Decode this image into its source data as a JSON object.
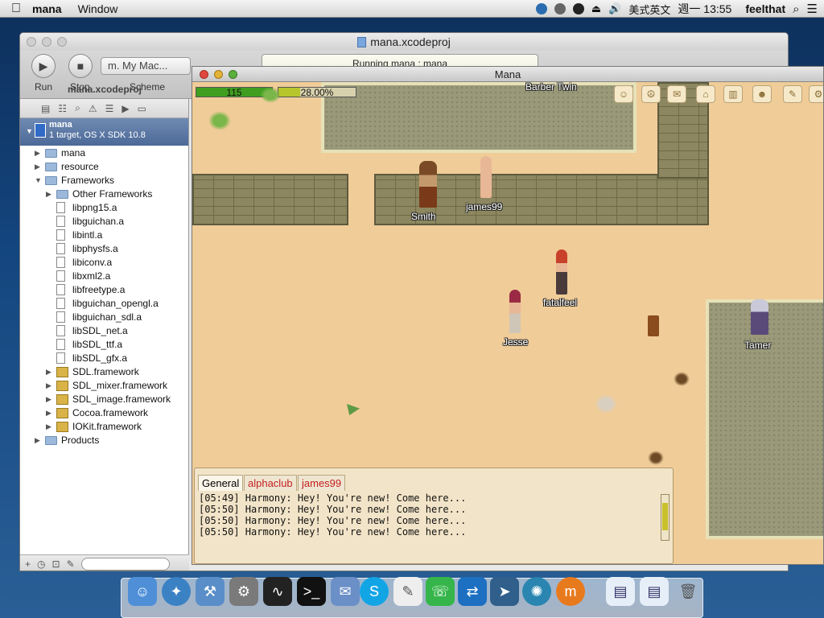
{
  "menubar": {
    "apple_glyph": "",
    "app_name": "mana",
    "menus": [
      "Window"
    ],
    "input_method": "美式英文",
    "clock": "週一 13:55",
    "user": "feelthat"
  },
  "xcode": {
    "window_title": "mana.xcodeproj",
    "run_label": "Run",
    "stop_label": "Stop",
    "scheme_text": "m.  My Mac...",
    "scheme_label": "Scheme",
    "status_text": "Running mana : mana",
    "project_tab": "mana.xcodeproj",
    "project": {
      "name": "mana",
      "subtitle": "1 target, OS X SDK 10.8"
    },
    "tree": [
      {
        "label": "mana",
        "kind": "folder",
        "depth": 0,
        "tri": "right"
      },
      {
        "label": "resource",
        "kind": "folder",
        "depth": 0,
        "tri": "right"
      },
      {
        "label": "Frameworks",
        "kind": "folder",
        "depth": 0,
        "tri": "down"
      },
      {
        "label": "Other Frameworks",
        "kind": "folder",
        "depth": 1,
        "tri": "right"
      },
      {
        "label": "libpng15.a",
        "kind": "lib",
        "depth": 1
      },
      {
        "label": "libguichan.a",
        "kind": "lib",
        "depth": 1
      },
      {
        "label": "libintl.a",
        "kind": "lib",
        "depth": 1
      },
      {
        "label": "libphysfs.a",
        "kind": "lib",
        "depth": 1
      },
      {
        "label": "libiconv.a",
        "kind": "lib",
        "depth": 1
      },
      {
        "label": "libxml2.a",
        "kind": "lib",
        "depth": 1
      },
      {
        "label": "libfreetype.a",
        "kind": "lib",
        "depth": 1
      },
      {
        "label": "libguichan_opengl.a",
        "kind": "lib",
        "depth": 1
      },
      {
        "label": "libguichan_sdl.a",
        "kind": "lib",
        "depth": 1
      },
      {
        "label": "libSDL_net.a",
        "kind": "lib",
        "depth": 1
      },
      {
        "label": "libSDL_ttf.a",
        "kind": "lib",
        "depth": 1
      },
      {
        "label": "libSDL_gfx.a",
        "kind": "lib",
        "depth": 1
      },
      {
        "label": "SDL.framework",
        "kind": "fw",
        "depth": 1,
        "tri": "right"
      },
      {
        "label": "SDL_mixer.framework",
        "kind": "fw",
        "depth": 1,
        "tri": "right"
      },
      {
        "label": "SDL_image.framework",
        "kind": "fw",
        "depth": 1,
        "tri": "right"
      },
      {
        "label": "Cocoa.framework",
        "kind": "fw",
        "depth": 1,
        "tri": "right"
      },
      {
        "label": "IOKit.framework",
        "kind": "fw",
        "depth": 1,
        "tri": "right"
      },
      {
        "label": "Products",
        "kind": "folder",
        "depth": 0,
        "tri": "right"
      }
    ]
  },
  "mana": {
    "window_title": "Mana",
    "hp_value": "115",
    "hp_fraction": 1.0,
    "xp_value": "28.00%",
    "xp_fraction": 0.28,
    "npcs": {
      "barber": "Barber Twin",
      "smith": "Smith",
      "james": "james99",
      "fatal": "fatalfeel",
      "jesse": "Jesse",
      "tamer": "Tamer"
    },
    "chat": {
      "tabs": [
        "General",
        "alphaclub",
        "james99"
      ],
      "lines": [
        "[05:49] Harmony: Hey! You're new! Come here...",
        "[05:50] Harmony: Hey! You're new! Come here...",
        "[05:50] Harmony: Hey! You're new! Come here...",
        "[05:50] Harmony: Hey! You're new! Come here..."
      ]
    }
  },
  "colors": {
    "hp_fill": "#3f9e1f",
    "xp_fill": "#b7c62c",
    "chat_tab_alert": "#c41e1e"
  },
  "dock_icons": [
    "finder-icon",
    "safari-icon",
    "xcode-icon",
    "system-preferences-icon",
    "activity-monitor-icon",
    "terminal-icon",
    "mail-icon",
    "skype-icon",
    "textedit-icon",
    "line-icon",
    "teamviewer-icon",
    "launchpad-icon",
    "network-icon",
    "mana-app-icon",
    "window-icon",
    "window-icon-2",
    "trash-icon"
  ]
}
